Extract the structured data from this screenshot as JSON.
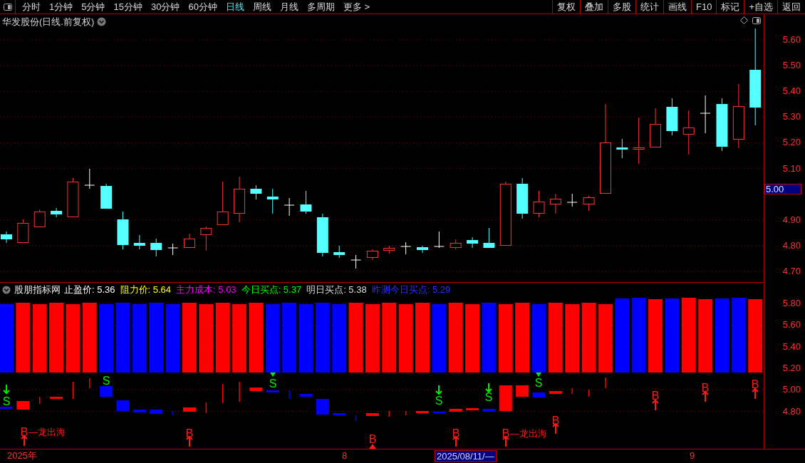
{
  "toolbar": {
    "tabs": [
      {
        "label": "分时",
        "selected": false
      },
      {
        "label": "1分钟",
        "selected": false
      },
      {
        "label": "5分钟",
        "selected": false
      },
      {
        "label": "15分钟",
        "selected": false
      },
      {
        "label": "30分钟",
        "selected": false
      },
      {
        "label": "60分钟",
        "selected": false
      },
      {
        "label": "日线",
        "selected": true
      },
      {
        "label": "周线",
        "selected": false
      },
      {
        "label": "月线",
        "selected": false
      },
      {
        "label": "多周期",
        "selected": false
      },
      {
        "label": "更多 >",
        "selected": false
      }
    ],
    "buttons": [
      "复权",
      "叠加",
      "多股",
      "统计",
      "画线",
      "F10",
      "标记",
      "+自选",
      "返回"
    ]
  },
  "chart": {
    "title": "华发股份(日线.前复权)",
    "price_axis": [
      "5.60",
      "5.50",
      "5.40",
      "5.30",
      "5.20",
      "5.10",
      "4.90",
      "4.80",
      "4.70"
    ],
    "price_tag": "5.00"
  },
  "indicator": {
    "name": "股朋指标网",
    "readouts": [
      {
        "label": "止盈价:",
        "value": "5.36",
        "color": "#ffffff"
      },
      {
        "label": "阻力价:",
        "value": "5.64",
        "color": "#ffff00"
      },
      {
        "label": "主力成本:",
        "value": "5.03",
        "color": "#ff00ff"
      },
      {
        "label": "今日买点:",
        "value": "5.37",
        "color": "#00ff00"
      },
      {
        "label": "明日买点:",
        "value": "5.38",
        "color": "#dcdcdc"
      },
      {
        "label": "昨测今日买点:",
        "value": "5.29",
        "color": "#2f2fff"
      }
    ],
    "axis": [
      "5.80",
      "5.60",
      "5.40",
      "5.20",
      "5.00",
      "4.80"
    ],
    "signals": [
      {
        "kind": "sell",
        "text": "S"
      },
      {
        "kind": "sell",
        "text": "S"
      },
      {
        "kind": "sell",
        "text": "S"
      },
      {
        "kind": "sell",
        "text": "S"
      },
      {
        "kind": "sell",
        "text": "S"
      },
      {
        "kind": "sell",
        "text": "S"
      },
      {
        "kind": "buy",
        "text": "B",
        "note": "—龙出海"
      },
      {
        "kind": "buy",
        "text": "B"
      },
      {
        "kind": "buy",
        "text": "B"
      },
      {
        "kind": "buy",
        "text": "B"
      },
      {
        "kind": "buy",
        "text": "B",
        "note": "—龙出海"
      },
      {
        "kind": "buy",
        "text": "B"
      },
      {
        "kind": "buy",
        "text": "B"
      },
      {
        "kind": "buy",
        "text": "B"
      },
      {
        "kind": "buy",
        "text": "B"
      }
    ]
  },
  "time_axis": [
    {
      "label": "2025年",
      "selected": false
    },
    {
      "label": "8",
      "selected": false
    },
    {
      "label": "2025/08/11/—",
      "selected": true
    },
    {
      "label": "9",
      "selected": false
    }
  ]
}
